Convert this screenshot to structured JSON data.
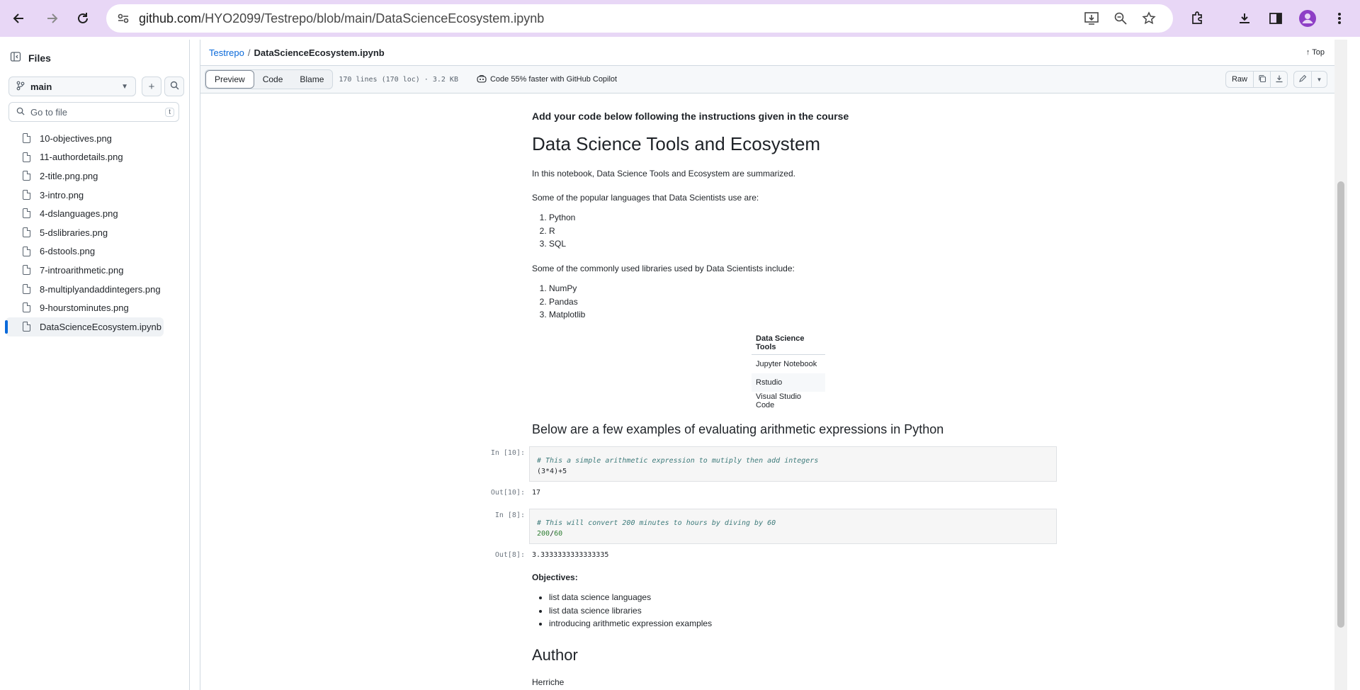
{
  "browser": {
    "url_main": "github.com",
    "url_path": "/HYO2099/Testrepo/blob/main/DataScienceEcosystem.ipynb"
  },
  "sidebar": {
    "title": "Files",
    "branch": "main",
    "search_placeholder": "Go to file",
    "search_shortcut": "t",
    "files": [
      "10-objectives.png",
      "11-authordetails.png",
      "2-title.png.png",
      "3-intro.png",
      "4-dslanguages.png",
      "5-dslibraries.png",
      "6-dstools.png",
      "7-introarithmetic.png",
      "8-multiplyandaddintegers.png",
      "9-hourstominutes.png",
      "DataScienceEcosystem.ipynb"
    ],
    "active_file": "DataScienceEcosystem.ipynb"
  },
  "breadcrumb": {
    "repo": "Testrepo",
    "separator": "/",
    "file": "DataScienceEcosystem.ipynb",
    "top_label": "Top"
  },
  "toolbar": {
    "tabs": [
      "Preview",
      "Code",
      "Blame"
    ],
    "active_tab": "Preview",
    "meta": "170 lines (170 loc) · 3.2 KB",
    "copilot": "Code 55% faster with GitHub Copilot",
    "raw": "Raw"
  },
  "notebook": {
    "intro_heading": "Add your code below following the instructions given in the course",
    "title": "Data Science Tools and Ecosystem",
    "summary": "In this notebook, Data Science Tools and Ecosystem are summarized.",
    "languages_intro": "Some of the popular languages that Data Scientists use are:",
    "languages": [
      "Python",
      "R",
      "SQL"
    ],
    "libraries_intro": "Some of the commonly used libraries used by Data Scientists include:",
    "libraries": [
      "NumPy",
      "Pandas",
      "Matplotlib"
    ],
    "tools_header": "Data Science Tools",
    "tools": [
      "Jupyter Notebook",
      "Rstudio",
      "Visual Studio Code"
    ],
    "arith_heading": "Below are a few examples of evaluating arithmetic expressions in Python",
    "cell1": {
      "in_prompt": "In [10]:",
      "comment": "# This a simple arithmetic expression to mutiply then add integers",
      "code": "(3*4)+5",
      "out_prompt": "Out[10]:",
      "output": "17"
    },
    "cell2": {
      "in_prompt": "In [8]:",
      "comment": "# This will convert 200 minutes to hours by diving by 60",
      "code_a": "200",
      "code_op": "/",
      "code_b": "60",
      "out_prompt": "Out[8]:",
      "output": "3.3333333333333335"
    },
    "objectives_label": "Objectives:",
    "objectives": [
      "list data science languages",
      "list data science libraries",
      "introducing arithmetic expression examples"
    ],
    "author_heading": "Author",
    "author": "Herriche"
  }
}
